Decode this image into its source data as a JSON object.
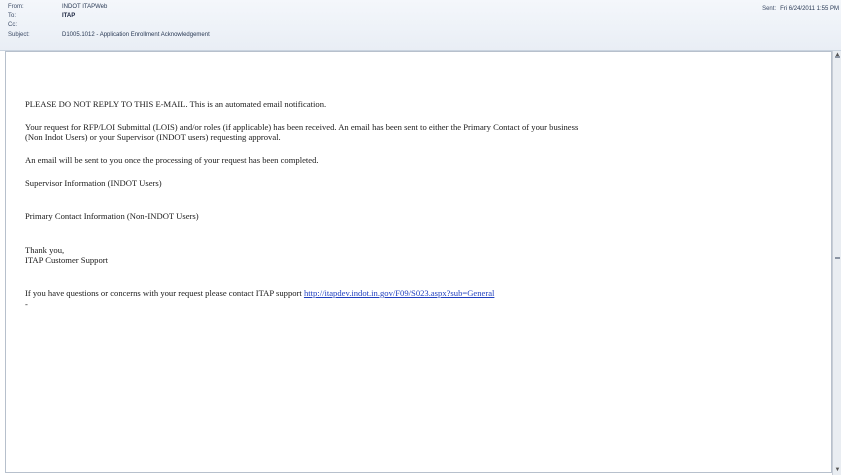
{
  "header": {
    "from_label": "From:",
    "from_value": "INDOT ITAPWeb",
    "to_label": "To:",
    "to_value": "ITAP",
    "cc_label": "Cc:",
    "cc_value": "",
    "subject_label": "Subject:",
    "subject_value": "D1005.1012 - Application Enrollment Acknowledgement",
    "sent_label": "Sent:",
    "sent_value": "Fri 6/24/2011 1:55 PM"
  },
  "message": {
    "notice": "PLEASE DO NOT REPLY TO THIS E-MAIL. This is an automated email notification.",
    "request_line1": "Your request for RFP/LOI Submittal (LOIS) and/or roles (if applicable) has been received. An email has been sent to either the Primary Contact of your business",
    "request_line2": "(Non Indot Users) or your Supervisor (INDOT users) requesting approval.",
    "processing": "An email will be sent to you once the processing of your request has been completed.",
    "supervisor_info": "Supervisor Information (INDOT Users)",
    "primary_contact_info": "Primary Contact Information (Non-INDOT Users)",
    "thanks": "Thank you,",
    "signature": "ITAP Customer Support",
    "questions_text": "If you have questions or concerns with your request please contact ITAP support ",
    "support_link": "http://itapdev.indot.in.gov/F09/S023.aspx?sub=General",
    "trailing_dash": "-"
  },
  "icons": {
    "scroll_up": "scroll-up-arrow-icon",
    "scroll_down": "scroll-down-arrow-icon"
  }
}
